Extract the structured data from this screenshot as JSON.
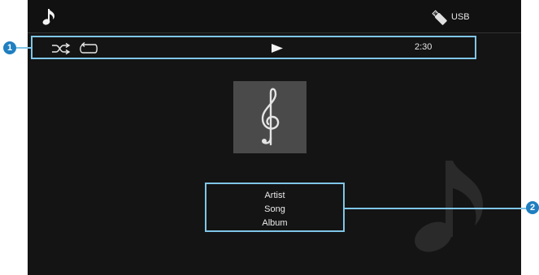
{
  "header": {
    "source_label": "USB",
    "music_icon": "music-note-icon",
    "source_icon": "usb-stick-icon"
  },
  "status": {
    "shuffle_icon": "shuffle-icon",
    "repeat_icon": "repeat-icon",
    "playback_icon": "play-icon",
    "elapsed_time": "2:30"
  },
  "track": {
    "artist": "Artist",
    "song": "Song",
    "album": "Album"
  },
  "callouts": {
    "status_bar": "1",
    "track_info": "2"
  },
  "colors": {
    "background": "#141414",
    "highlight": "#7fc6e8",
    "callout": "#1f7fc0",
    "album_art": "#4a4a4a"
  }
}
